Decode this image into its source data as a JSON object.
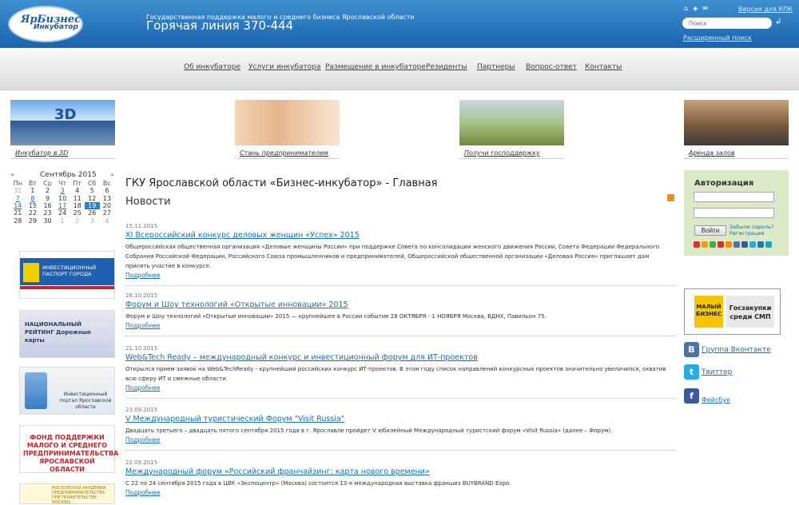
{
  "header": {
    "logo_line1": "ЯрБизнес",
    "logo_line2": "Инкубатор",
    "tagline": "Государственная поддержка малого и среднего бизнеса Ярославской области",
    "hotline": "Горячая линия 370-444",
    "kpk_link": "Версия для КПК",
    "search_placeholder": "Поиск",
    "search_submit": "↲",
    "advanced_search": "Расширенный поиск"
  },
  "nav": {
    "items": [
      {
        "label": "Об инкубаторе"
      },
      {
        "label": "Услуги инкубатора"
      },
      {
        "label": "Размещение в инкубаторе"
      },
      {
        "label": "Резиденты"
      },
      {
        "label": "Партнеры"
      },
      {
        "label": "Вопрос-ответ"
      },
      {
        "label": "Контакты"
      }
    ]
  },
  "banners": [
    {
      "caption": "Инкубатор в 3D",
      "label": "3D"
    },
    {
      "caption": "Стань предпринимателем"
    },
    {
      "caption": "Получи господдержку"
    },
    {
      "caption": "Аренда залов"
    }
  ],
  "calendar": {
    "title": "Сентябрь 2015",
    "prev": "«",
    "next": "»",
    "weekdays": [
      "Пн",
      "Вт",
      "Ср",
      "Чт",
      "Пт",
      "Сб",
      "Вс"
    ],
    "weeks": [
      [
        "31",
        "1",
        "2",
        "3",
        "4",
        "5",
        "6"
      ],
      [
        "7",
        "8",
        "9",
        "10",
        "11",
        "12",
        "13"
      ],
      [
        "14",
        "15",
        "16",
        "17",
        "18",
        "19",
        "20"
      ],
      [
        "21",
        "22",
        "23",
        "24",
        "25",
        "26",
        "27"
      ],
      [
        "28",
        "29",
        "30",
        "1",
        "2",
        "3",
        "4"
      ]
    ]
  },
  "left_banners": [
    {
      "text": "ИНВЕСТИЦИОННЫЙ ПАСПОРТ ГОРОДА"
    },
    {
      "text": "НАЦИОНАЛЬНЫЙ РЕЙТИНГ Дорожные карты"
    },
    {
      "text": "Инвестиционный портал Ярославской области"
    },
    {
      "text": "ФОНД ПОДДЕРЖКИ МАЛОГО И СРЕДНЕГО ПРЕДПРИНИМАТЕЛЬСТВА ЯРОСЛАВСКОЙ ОБЛАСТИ"
    },
    {
      "text": "МОСКОВСКАЯ АКАДЕМИЯ ПРЕДПРИНИМАТЕЛЬСТВА ПРИ ПРАВИТЕЛЬСТВЕ МОСКВЫ"
    }
  ],
  "main": {
    "page_title": "ГКУ Ярославской области «Бизнес-инкубатор» - Главная",
    "section_title": "Новости",
    "news": [
      {
        "date": "15.11.2015",
        "title": "XI Всероссийский конкурс деловых женщин «Успех» 2015",
        "body": "Общероссийская общественная организация «Деловые женщины России» при поддержке Совета по консолидации женского движения России, Совета Федерации Федерального Собрания Российской Федерации, Российского Союза промышленников и предпринимателей, Общероссийской общественной организации «Деловая Россия» приглашает дам принять участие в конкурсе.",
        "more": "Подробнее"
      },
      {
        "date": "28.10.2015",
        "title": "Форум и Шоу технологий «Открытые инновации» 2015",
        "body": "Форум и Шоу технологий «Открытые инновации» 2015 — крупнейшее в России событие 28 ОКТЯБРЯ - 1 НОЯБРЯ Москва, ВДНХ, Павильон 75.",
        "more": "Подробнее"
      },
      {
        "date": "21.10.2015",
        "title": "Web&Tech Ready – международный конкурс и инвестиционный форум для ИТ-проектов",
        "body": "Открылся прием заявок на Web&TechReady - крупнейший российских конкурс ИТ-проектов. В этом году список направлений конкурсных проектов значительно увеличился, охватив всю сферу ИТ и смежные области.",
        "more": "Подробнее"
      },
      {
        "date": "23.09.2015",
        "title": "V Международный туристический Форум \"Visit Russia\"",
        "body": "Двадцать третьего – двадцать пятого сентября 2015 года в г. Ярославле пройдет V юбилейный Международный туристский форум «Visit Russia» (далее – Форум).",
        "more": "Подробнее"
      },
      {
        "date": "22.09.2015",
        "title": "Международный форум «Российский франчайзинг: карта нового времени»",
        "body": "С 22 по 24 сентября 2015 года в ЦВК «Экспоцентр» (Москва) состоится 13-я международная выставка франшиз BUYBRAND Expo.",
        "more": "Подробнее"
      }
    ]
  },
  "auth": {
    "title": "Авторизация",
    "login_button": "Войти",
    "forgot": "Забыли пароль?",
    "register": "Регистрация"
  },
  "smp": {
    "logo": "МАЛЫЙ БИЗНЕС",
    "text": "Госзакупки среди СМП"
  },
  "social": {
    "vk_label": "Группа Вконтакте",
    "twitter_label": "Твиттер",
    "facebook_label": "Фейсбук"
  },
  "colors": {
    "header_top": "#3f8fd0",
    "header_bottom": "#1a63ad",
    "link": "#1a6fae",
    "today": "#2a82c6",
    "auth_bg": "#dbe9c8"
  }
}
